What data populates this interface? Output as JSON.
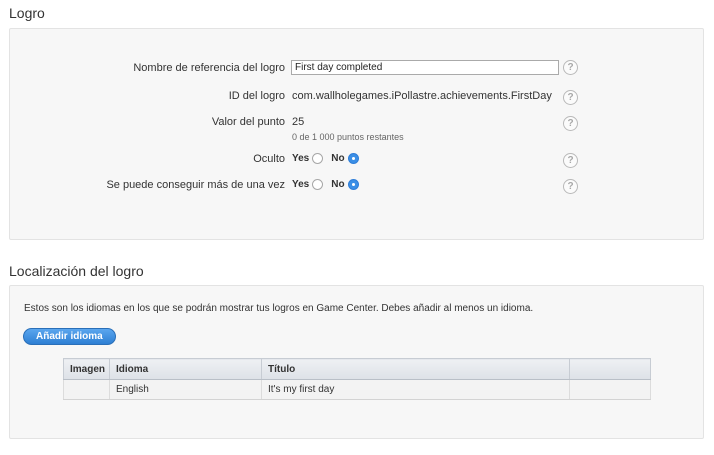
{
  "achievement": {
    "section_title": "Logro",
    "fields": {
      "reference_name": {
        "label": "Nombre de referencia del logro",
        "value": "First day completed"
      },
      "id": {
        "label": "ID del logro",
        "value": "com.wallholegames.iPollastre.achievements.FirstDay"
      },
      "points": {
        "label": "Valor del punto",
        "value": "25",
        "remaining": "0 de 1 000 puntos restantes"
      },
      "hidden": {
        "label": "Oculto",
        "yes": "Yes",
        "no": "No",
        "selected": "No"
      },
      "repeatable": {
        "label": "Se puede conseguir más de una vez",
        "yes": "Yes",
        "no": "No",
        "selected": "No"
      }
    },
    "help_glyph": "?"
  },
  "localization": {
    "section_title": "Localización del logro",
    "intro": "Estos son los idiomas en los que se podrán mostrar tus logros en Game Center. Debes añadir al menos un idioma.",
    "add_button": "Añadir idioma",
    "table": {
      "columns": [
        "Imagen",
        "Idioma",
        "Título",
        ""
      ],
      "rows": [
        {
          "image": "",
          "language": "English",
          "title": "It's my first day",
          "extra": ""
        }
      ]
    }
  },
  "colors": {
    "accent": "#3b8fe6",
    "panel_bg": "#f7f7f7"
  },
  "icons": {
    "help": "help-icon",
    "radio_checked": "radio-checked",
    "radio_empty": "radio-empty"
  }
}
